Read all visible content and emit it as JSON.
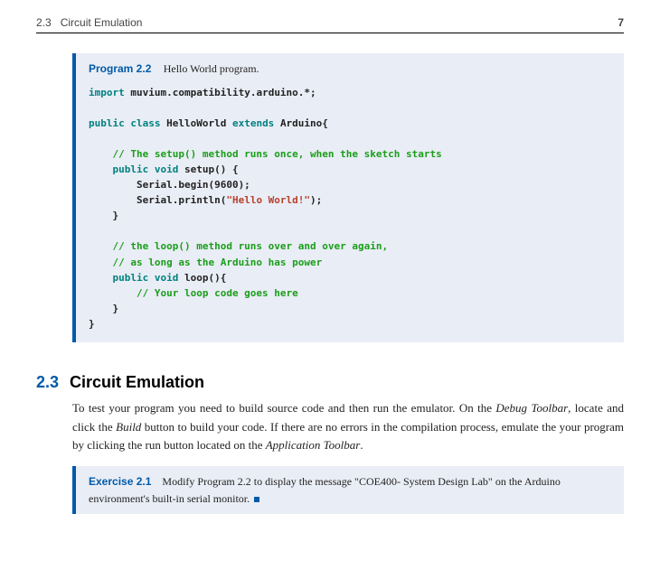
{
  "header": {
    "section_label": "2.3",
    "section_name": "Circuit Emulation",
    "page_number": "7"
  },
  "program_box": {
    "label": "Program 2.2",
    "caption": "Hello World program.",
    "code": {
      "l01a": "import",
      "l01b": " muvium.compatibility.arduino.*;",
      "l03a": "public class ",
      "l03b": "HelloWorld",
      "l03c": " extends ",
      "l03d": "Arduino",
      "l03e": "{",
      "l05": "    // The setup() method runs once, when the sketch starts",
      "l06a": "    public void ",
      "l06b": "setup",
      "l06c": "() {",
      "l07": "        Serial.begin(9600);",
      "l08a": "        Serial.println(",
      "l08b": "\"Hello World!\"",
      "l08c": ");",
      "l09": "    }",
      "l11": "    // the loop() method runs over and over again,",
      "l12": "    // as long as the Arduino has power",
      "l13a": "    public void ",
      "l13b": "loop",
      "l13c": "(){",
      "l14": "        // Your loop code goes here",
      "l15": "    }",
      "l16": "}"
    }
  },
  "section": {
    "number": "2.3",
    "title": "Circuit Emulation",
    "para_1a": "To test your program you need to build source code and then run the emulator. On the ",
    "para_1b": "Debug Toolbar",
    "para_1c": ", locate and click the ",
    "para_1d": "Build",
    "para_1e": " button to build your code. If there are no errors in the compilation process, emulate the your program by clicking the run button located on the ",
    "para_1f": "Application Toolbar",
    "para_1g": "."
  },
  "exercise_box": {
    "label": "Exercise 2.1",
    "text": "Modify Program 2.2 to display the message \"COE400- System Design Lab\" on the Arduino environment's built-in serial monitor."
  }
}
